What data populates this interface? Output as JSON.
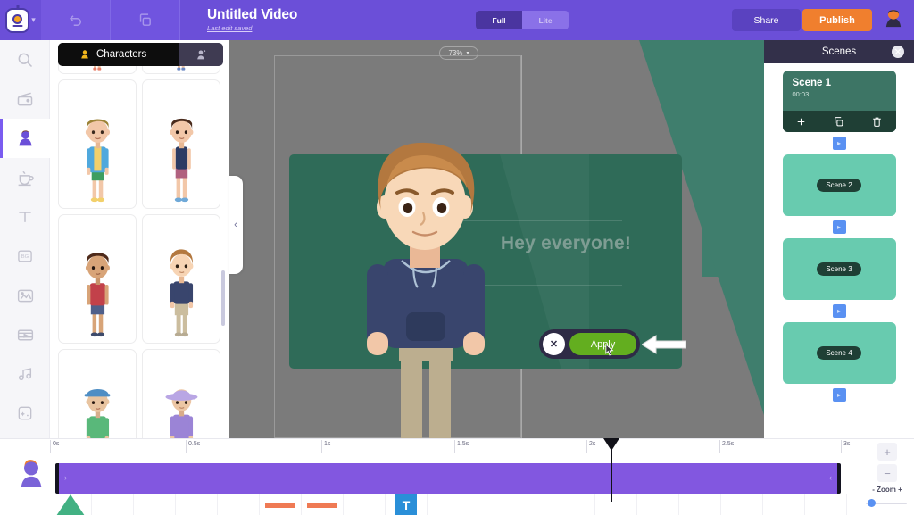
{
  "topbar": {
    "logo_icon": "robot-logo-icon",
    "logo_caret_icon": "chevron-down-icon",
    "undo_icon": "undo-icon",
    "copy_icon": "copy-icon",
    "title": "Untitled Video",
    "subtitle": "Last edit saved",
    "modes": [
      {
        "label": "Full",
        "active": true
      },
      {
        "label": "Lite",
        "active": false
      }
    ],
    "share_label": "Share",
    "publish_label": "Publish",
    "avatar_icon": "user-avatar-icon",
    "bg_color": "#6b4fd8",
    "publish_color": "#f07f2e"
  },
  "rail": {
    "items": [
      {
        "icon": "search-icon",
        "active": false
      },
      {
        "icon": "video-clapper-icon",
        "active": false
      },
      {
        "icon": "character-icon",
        "active": true
      },
      {
        "icon": "prop-icon",
        "active": false
      },
      {
        "icon": "text-icon",
        "active": false
      },
      {
        "icon": "background-icon",
        "active": false
      },
      {
        "icon": "image-icon",
        "active": false
      },
      {
        "icon": "video-icon",
        "active": false
      },
      {
        "icon": "music-icon",
        "active": false
      },
      {
        "icon": "effects-icon",
        "active": false
      },
      {
        "icon": "upload-icon",
        "active": false
      }
    ]
  },
  "characters_panel": {
    "tab_label": "Characters",
    "tab_icon": "person-icon",
    "alt_tab_icon": "person-add-icon",
    "items": [
      {
        "name": "character-partial-1"
      },
      {
        "name": "character-partial-2"
      },
      {
        "name": "character-boy-blue-jacket"
      },
      {
        "name": "character-boy-navy-tank"
      },
      {
        "name": "character-boy-red-shirt"
      },
      {
        "name": "character-teen-navy-hoodie"
      },
      {
        "name": "character-boy-cap-green"
      },
      {
        "name": "character-woman-purple-hat"
      }
    ],
    "collapse_icon": "chevron-left-icon"
  },
  "canvas": {
    "zoom_level": "73%",
    "zoom_caret_icon": "chevron-down-icon",
    "slide_text": "Hey everyone!",
    "slide_color": "#2f6b58",
    "bg_color": "#7b7b7b",
    "character_name": "character-teen-navy-hoodie-large",
    "apply_label": "Apply",
    "apply_color": "#63ae1f",
    "close_icon": "close-x-icon",
    "cursor_icon": "pointer-cursor-icon",
    "callout_arrow_icon": "arrow-left-pointer-icon"
  },
  "scenes_panel": {
    "title": "Scenes",
    "close_icon": "close-x-icon",
    "transition_icon": "transition-icon",
    "scenes": [
      {
        "label": "Scene 1",
        "duration": "00:03",
        "selected": true,
        "actions": [
          {
            "icon": "plus-icon",
            "glyph": "+"
          },
          {
            "icon": "duplicate-icon",
            "glyph": "⧉"
          },
          {
            "icon": "trash-icon",
            "glyph": "🗑"
          }
        ]
      },
      {
        "label": "Scene 2",
        "selected": false
      },
      {
        "label": "Scene 3",
        "selected": false
      },
      {
        "label": "Scene 4",
        "selected": false
      }
    ]
  },
  "timeline": {
    "avatar_icon": "character-avatar-icon",
    "ticks": [
      "0s",
      "0.5s",
      "1s",
      "1.5s",
      "2s",
      "2.5s",
      "3s"
    ],
    "track_color": "#8257e0",
    "track_handle_left_icon": "chevron-right-icon",
    "track_handle_right_icon": "chevron-left-icon",
    "playhead_position": "2s",
    "assets": [
      {
        "type": "triangle",
        "name": "shape-asset"
      },
      {
        "type": "bar",
        "name": "audio-asset-1"
      },
      {
        "type": "bar",
        "name": "audio-asset-2"
      },
      {
        "type": "text",
        "name": "text-asset",
        "glyph": "T"
      }
    ],
    "zoom_in_label": "+",
    "zoom_out_label": "−",
    "zoom_label": "Zoom",
    "zoom_minus": "-",
    "zoom_plus": "+"
  }
}
